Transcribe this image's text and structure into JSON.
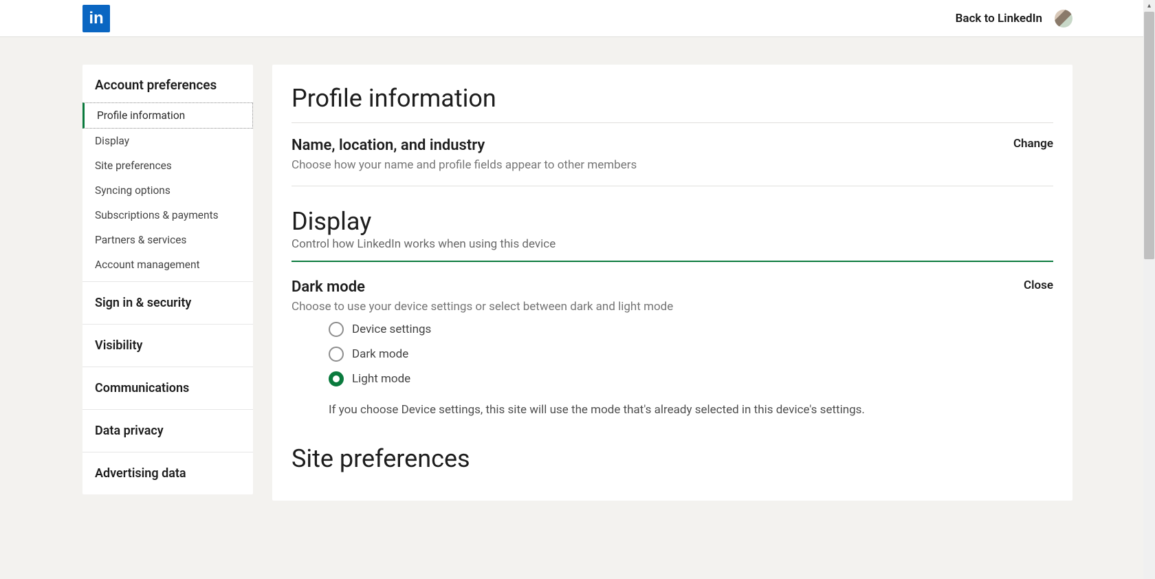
{
  "header": {
    "logo_text": "in",
    "back_label": "Back to LinkedIn"
  },
  "sidebar": {
    "top_section": {
      "title": "Account preferences",
      "items": [
        {
          "label": "Profile information",
          "active": true
        },
        {
          "label": "Display",
          "active": false
        },
        {
          "label": "Site preferences",
          "active": false
        },
        {
          "label": "Syncing options",
          "active": false
        },
        {
          "label": "Subscriptions & payments",
          "active": false
        },
        {
          "label": "Partners & services",
          "active": false
        },
        {
          "label": "Account management",
          "active": false
        }
      ]
    },
    "sections": [
      {
        "label": "Sign in & security"
      },
      {
        "label": "Visibility"
      },
      {
        "label": "Communications"
      },
      {
        "label": "Data privacy"
      },
      {
        "label": "Advertising data"
      }
    ]
  },
  "content": {
    "profile": {
      "title": "Profile information",
      "row_title": "Name, location, and industry",
      "row_desc": "Choose how your name and profile fields appear to other members",
      "action": "Change"
    },
    "display": {
      "title": "Display",
      "subtitle": "Control how LinkedIn works when using this device",
      "dark_mode": {
        "title": "Dark mode",
        "desc": "Choose to use your device settings or select between dark and light mode",
        "action": "Close",
        "options": [
          {
            "label": "Device settings",
            "selected": false
          },
          {
            "label": "Dark mode",
            "selected": false
          },
          {
            "label": "Light mode",
            "selected": true
          }
        ],
        "note": "If you choose Device settings, this site will use the mode that's already selected in this device's settings."
      }
    },
    "site_prefs": {
      "title": "Site preferences"
    }
  }
}
